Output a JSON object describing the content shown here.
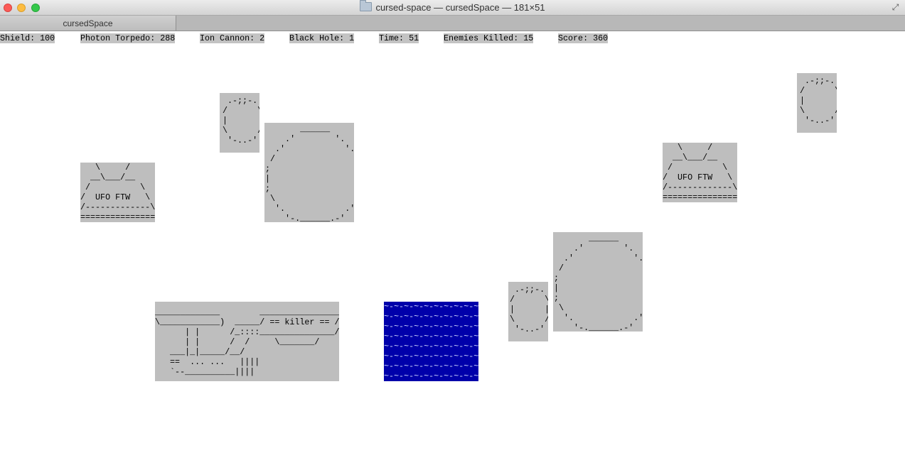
{
  "window": {
    "title": "cursed-space — cursedSpace — 181×51",
    "tab": "cursedSpace"
  },
  "hud": {
    "shield": "Shield: 100",
    "photon": "Photon Torpedo: 288",
    "ion": "Ion Cannon: 2",
    "blackhole": "Black Hole: 1",
    "time": "Time: 51",
    "killed": "Enemies Killed: 15",
    "score": "Score: 360"
  },
  "sprites": {
    "asteroid_small": " .-;;-.\n/      \\\n|      |\n\\      /\n '-..-'",
    "asteroid_big": "       ______\n    .'        '.\n  .'            '.\n /                \\\n;                  ;\n|                  |\n;                  ;\n \\                /\n  '.            .'\n    '-.______.-'",
    "ufo": "   \\     /\n  __\\___/__\n /          \\\n/  UFO FTW   \\\n/-------------\\\n===============",
    "player_ship": "_____________        ________________\n\\____________)  _____/ == killer == /\n      | |      /_::::_______________/\n      | |      /  /     \\_______/\n   ___|_|_____/__/\n   ==  ... ...   ||||\n   `--__________||||",
    "laser_beam": "~-~-~-~-~-~-~-~-~-~-~-~-~-~-~-~\n~-~-~-~-~-~-~-~-~-~-~-~-~-~-~-~\n~-~-~-~-~-~-~-~-~-~-~-~-~-~-~-~\n~-~-~-~-~-~-~-~-~-~-~-~-~-~-~-~\n~-~-~-~-~-~-~-~-~-~-~-~-~-~-~-~\n~-~-~-~-~-~-~-~-~-~-~-~-~-~-~-~\n~-~-~-~-~-~-~-~-~-~-~-~-~-~-~-~\n~-~-~-~-~-~-~-~-~-~-~-~-~-~-~-~"
  },
  "colors": {
    "sprite_bg": "#bebebe",
    "laser_bg": "#0000aa"
  }
}
